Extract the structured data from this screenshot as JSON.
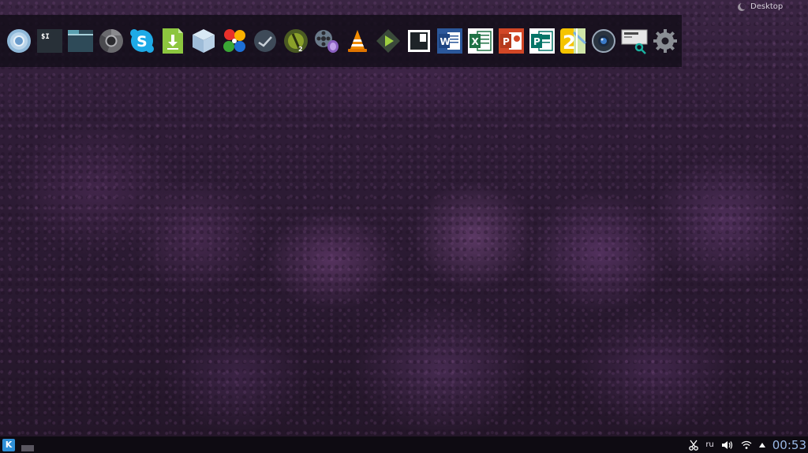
{
  "desktop": {
    "label": "Desktop"
  },
  "dock": {
    "items": [
      {
        "name": "chromium",
        "icon": "chromium-icon"
      },
      {
        "name": "terminal",
        "icon": "terminal-icon"
      },
      {
        "name": "file-manager",
        "icon": "folder-icon"
      },
      {
        "name": "chrome",
        "icon": "chrome-icon"
      },
      {
        "name": "skype",
        "icon": "skype-icon"
      },
      {
        "name": "downloader",
        "icon": "download-icon"
      },
      {
        "name": "virtualbox",
        "icon": "cube-icon"
      },
      {
        "name": "playonlinux",
        "icon": "clover-icon"
      },
      {
        "name": "steam",
        "icon": "steam-icon"
      },
      {
        "name": "game",
        "icon": "game-icon"
      },
      {
        "name": "media-converter",
        "icon": "film-reel-icon"
      },
      {
        "name": "vlc",
        "icon": "vlc-cone-icon"
      },
      {
        "name": "media-player",
        "icon": "play-icon"
      },
      {
        "name": "screenshot",
        "icon": "screenshot-icon"
      },
      {
        "name": "word",
        "icon": "word-icon",
        "letter": "W",
        "color": "#2b579a"
      },
      {
        "name": "excel",
        "icon": "excel-icon",
        "letter": "X",
        "color": "#217346"
      },
      {
        "name": "powerpoint",
        "icon": "powerpoint-icon",
        "letter": "P",
        "color": "#d24726"
      },
      {
        "name": "publisher",
        "icon": "publisher-icon",
        "letter": "P",
        "color": "#077568"
      },
      {
        "name": "2gis",
        "icon": "map-2gis-icon",
        "letter": "2"
      },
      {
        "name": "webcam",
        "icon": "webcam-icon"
      },
      {
        "name": "network-manager",
        "icon": "network-monitor-icon"
      },
      {
        "name": "settings",
        "icon": "gear-icon"
      }
    ]
  },
  "panel": {
    "kmenu_glyph": "K",
    "tray": {
      "keyboard_layout": "ru",
      "clock": "00:53"
    }
  }
}
